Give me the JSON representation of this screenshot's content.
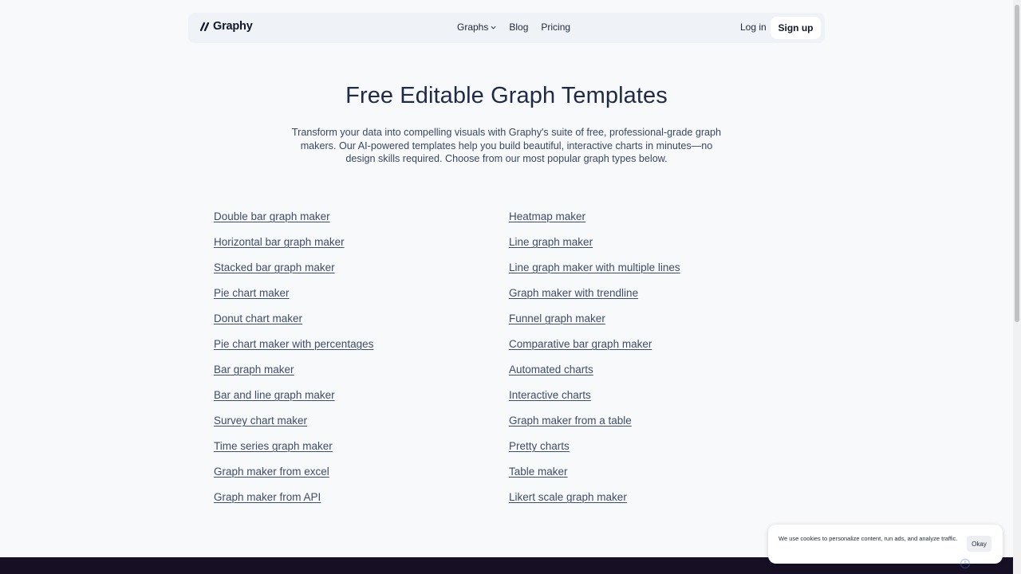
{
  "header": {
    "brand": "Graphy",
    "nav": {
      "graphs": "Graphs",
      "blog": "Blog",
      "pricing": "Pricing"
    },
    "login": "Log in",
    "signup": "Sign up"
  },
  "hero": {
    "title": "Free Editable Graph Templates",
    "description": "Transform your data into compelling visuals with Graphy's suite of free, professional-grade graph makers. Our AI-powered templates help you build beautiful, interactive charts in minutes—no design skills required. Choose from our most popular graph types below."
  },
  "links": {
    "left": [
      "Double bar graph maker",
      "Horizontal bar graph maker",
      "Stacked bar graph maker",
      "Pie chart maker",
      "Donut chart maker",
      "Pie chart maker with percentages",
      "Bar graph maker",
      "Bar and line graph maker",
      "Survey chart maker",
      "Time series graph maker",
      "Graph maker from excel",
      "Graph maker from API"
    ],
    "right": [
      "Heatmap maker",
      "Line graph maker",
      "Line graph maker with multiple lines",
      "Graph maker with trendline",
      "Funnel graph maker",
      "Comparative bar graph maker",
      "Automated charts",
      "Interactive charts",
      "Graph maker from a table",
      "Pretty charts",
      "Table maker",
      "Likert scale graph maker"
    ]
  },
  "cookie": {
    "text": "We use cookies to personalize content, run ads, and analyze traffic.",
    "button": "Okay"
  },
  "colors": {
    "page_bg": "#f8f9fb",
    "nav_bg": "#eff3f8",
    "title": "#1e2a47",
    "link": "#3f4c68",
    "footer": "#170f23"
  }
}
